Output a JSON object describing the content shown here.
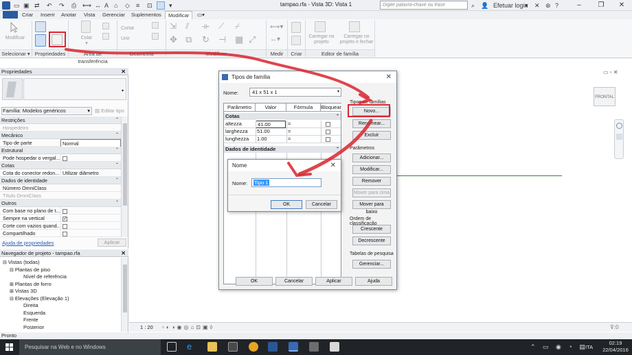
{
  "titlebar": {
    "title": "tampao.rfa - Vista 3D: Vista 1",
    "search_placeholder": "Digite palavra-chave ou frase",
    "login": "Efetuar login",
    "help": "?"
  },
  "tabs": [
    "Criar",
    "Inserir",
    "Anotar",
    "Vista",
    "Gerenciar",
    "Suplementos",
    "Modificar"
  ],
  "ribbon": {
    "groups": {
      "selecionar": "Selecionar ▾",
      "propriedades": "Propriedades",
      "area_transferencia": "Área de transferência",
      "geometria": "Geometria",
      "modificar": "Modificar",
      "medir": "Medir",
      "criar": "Criar",
      "editor_familia": "Editor de família"
    },
    "buttons": {
      "modificar": "Modificar",
      "colar": "Colar",
      "cortar": "Cortar",
      "unir": "Unir",
      "carregar_projeto": "Carregar no projeto",
      "carregar_fechar": "Carregar no projeto e fechar"
    }
  },
  "properties": {
    "title": "Propriedades",
    "family_selector": "Família: Modelos genéricos",
    "edit_type": "Editar tipo",
    "rows": [
      {
        "type": "cat",
        "label": "Restrições"
      },
      {
        "type": "row",
        "key": "Hospedeiro",
        "value": "",
        "dim": true
      },
      {
        "type": "cat",
        "label": "Mecânico"
      },
      {
        "type": "row",
        "key": "Tipo de parte",
        "value": "Normal"
      },
      {
        "type": "cat",
        "label": "Estrutural"
      },
      {
        "type": "row",
        "key": "Pode hospedar o vergal...",
        "check": false
      },
      {
        "type": "cat",
        "label": "Cotas"
      },
      {
        "type": "row",
        "key": "Cota do conector redon...",
        "value": "Utilizar diâmetro"
      },
      {
        "type": "cat",
        "label": "Dados de identidade"
      },
      {
        "type": "row",
        "key": "Número OmniClass",
        "value": ""
      },
      {
        "type": "row",
        "key": "Título OmniClass",
        "value": "",
        "dim": true
      },
      {
        "type": "cat",
        "label": "Outros"
      },
      {
        "type": "row",
        "key": "Com base no plano de t...",
        "check": false
      },
      {
        "type": "row",
        "key": "Sempre na vertical",
        "check": true
      },
      {
        "type": "row",
        "key": "Corte com vazios quand...",
        "check": false
      },
      {
        "type": "row",
        "key": "Compartilhado",
        "check": false
      }
    ],
    "help_link": "Ajuda de propriedades",
    "apply": "Aplicar"
  },
  "navigator": {
    "title": "Navegador de projeto - tampao.rfa",
    "items": [
      {
        "label": "Vistas (todas)",
        "indent": 0,
        "sign": "⊟"
      },
      {
        "label": "Plantas de piso",
        "indent": 1,
        "sign": "⊟"
      },
      {
        "label": "Nível de referência",
        "indent": 2,
        "sign": ""
      },
      {
        "label": "Plantas de forro",
        "indent": 1,
        "sign": "⊞"
      },
      {
        "label": "Vistas 3D",
        "indent": 1,
        "sign": "⊞"
      },
      {
        "label": "Elevações (Elevação 1)",
        "indent": 1,
        "sign": "⊟"
      },
      {
        "label": "Direita",
        "indent": 2,
        "sign": ""
      },
      {
        "label": "Esquerda",
        "indent": 2,
        "sign": ""
      },
      {
        "label": "Frente",
        "indent": 2,
        "sign": ""
      },
      {
        "label": "Posterior",
        "indent": 2,
        "sign": ""
      }
    ]
  },
  "view": {
    "scale": "1 : 20",
    "viewcube": "FRONTAL"
  },
  "status": "Pronto",
  "family_types_dialog": {
    "title": "Tipos de família",
    "name_label": "Nome:",
    "name_value": "41 x 51 x 1",
    "columns": [
      "Parâmetro",
      "Valor",
      "Fórmula",
      "Bloquear"
    ],
    "sections": [
      {
        "label": "Cotas",
        "rows": [
          {
            "param": "altezza",
            "value": "41.00",
            "formula": "="
          },
          {
            "param": "larghezza",
            "value": "51.00",
            "formula": "="
          },
          {
            "param": "lunghezza",
            "value": "1.00",
            "formula": "="
          }
        ]
      },
      {
        "label": "Dados de identidade",
        "rows": []
      }
    ],
    "family_types_group": "Tipos de famílias",
    "novo": "Novo...",
    "renomear": "Renomear...",
    "excluir": "Excluir",
    "params_group": "Parâmetros",
    "adicionar": "Adicionar...",
    "modificar": "Modificar...",
    "remover": "Remover",
    "mover_cima": "Mover para cima",
    "mover_baixo": "Mover para baixo",
    "order_group": "Ordem de classificação",
    "crescente": "Crescente",
    "decrescente": "Decrescente",
    "lookup_group": "Tabelas de pesquisa",
    "gerenciar": "Gerenciar...",
    "ok": "OK",
    "cancelar": "Cancelar",
    "aplicar": "Aplicar",
    "ajuda": "Ajuda"
  },
  "name_dialog": {
    "title": "Nome",
    "label": "Nome:",
    "value": "Tipo 1",
    "ok": "OK",
    "cancel": "Cancelar"
  },
  "taskbar": {
    "search": "Pesquisar na Web e no Windows",
    "lang": "ITA",
    "time": "02:19",
    "date": "22/04/2016"
  },
  "colors": {
    "annotation_red": "#d9252f",
    "selection_blue": "#3399ff",
    "taskbar": "#202428"
  }
}
